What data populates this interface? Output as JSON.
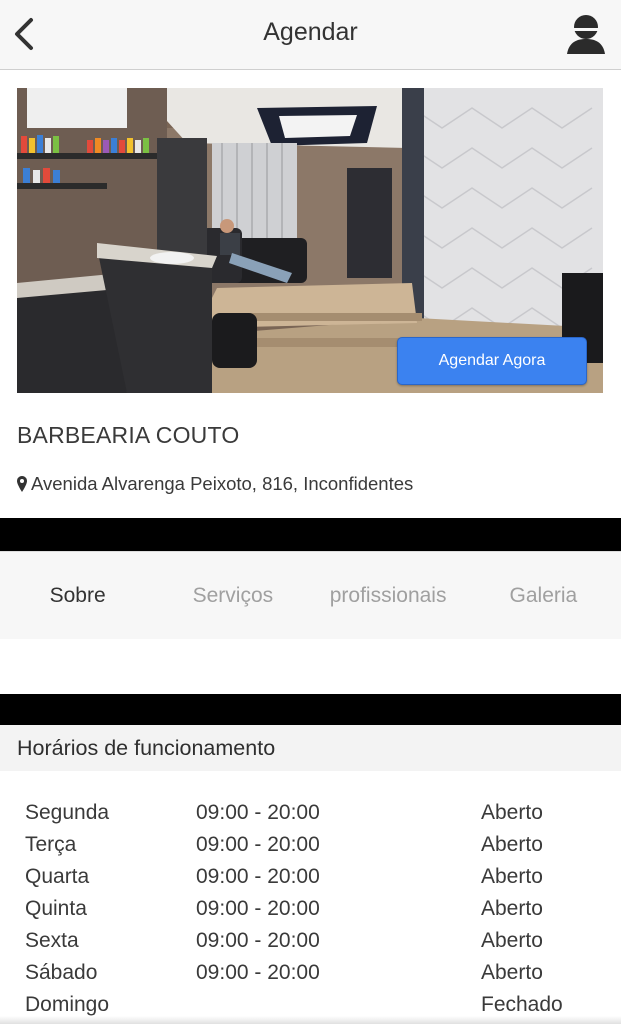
{
  "header": {
    "title": "Agendar",
    "back_icon": "chevron-left-icon",
    "profile_icon": "user-profile-icon"
  },
  "hero": {
    "image_description_icon": "barbershop-photo",
    "cta_label": "Agendar Agora",
    "cta_color": "#3b82f0"
  },
  "shop": {
    "name": "BARBEARIA COUTO",
    "address": "Avenida Alvarenga Peixoto, 816, Inconfidentes",
    "address_icon": "map-pin-icon"
  },
  "tabs": [
    {
      "label": "Sobre",
      "active": true
    },
    {
      "label": "Serviços",
      "active": false
    },
    {
      "label": "profissionais",
      "active": false
    },
    {
      "label": "Galeria",
      "active": false
    }
  ],
  "hours": {
    "title": "Horários de funcionamento",
    "rows": [
      {
        "day": "Segunda",
        "time": "09:00 - 20:00",
        "status": "Aberto"
      },
      {
        "day": "Terça",
        "time": "09:00 - 20:00",
        "status": "Aberto"
      },
      {
        "day": "Quarta",
        "time": "09:00 - 20:00",
        "status": "Aberto"
      },
      {
        "day": "Quinta",
        "time": "09:00 - 20:00",
        "status": "Aberto"
      },
      {
        "day": "Sexta",
        "time": "09:00 - 20:00",
        "status": "Aberto"
      },
      {
        "day": "Sábado",
        "time": "09:00 - 20:00",
        "status": "Aberto"
      },
      {
        "day": "Domingo",
        "time": "",
        "status": "Fechado"
      }
    ]
  }
}
